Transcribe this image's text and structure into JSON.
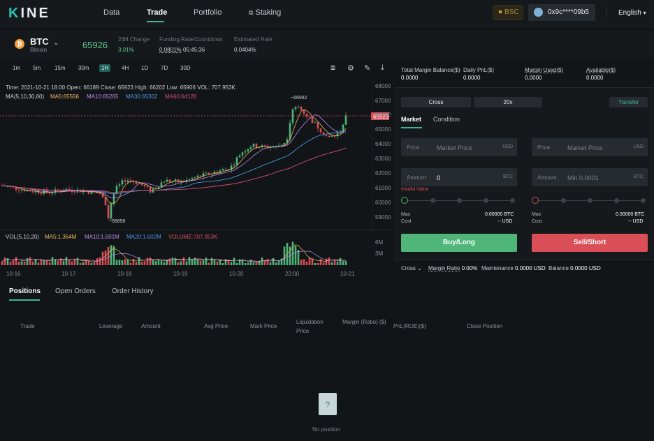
{
  "nav": {
    "logo": "KINE",
    "items": [
      "Data",
      "Trade",
      "Portfolio",
      "Staking"
    ],
    "network": "BSC",
    "address": "0x9c****09b5",
    "language": "English"
  },
  "ticker": {
    "symbol": "BTC",
    "name": "Bitcoin",
    "price": "65926",
    "change_label": "24H Change",
    "change_value": "3.01%",
    "funding_label": "Funding Rate/Countdown",
    "funding_rate": "0.0801%",
    "funding_countdown": "05:45:36",
    "est_label": "Estimated Rate",
    "est_value": "0.0404%"
  },
  "chart_toolbar": {
    "timeframes": [
      "1m",
      "5m",
      "15m",
      "30m",
      "1H",
      "4H",
      "1D",
      "7D",
      "30D"
    ],
    "active": "1H"
  },
  "chart_legend": {
    "ohlc": "Time: 2021-10-21 18:00    Open: 66189    Close: 65923    High: 66202    Low: 65906    VOL: 707.953K",
    "ma_title": "MA(5,10,30,60)",
    "ma5": "MA5:65556",
    "ma10": "MA10:65265",
    "ma30": "MA30:65302",
    "ma60": "MA60:64126",
    "vol_title": "VOL(5,10,20)",
    "vma5": "MA5:1.364M",
    "vma10": "MA10:1.601M",
    "vma20": "MA20:1.602M",
    "volume": "VOLUME:707.953K",
    "high_marker": "66982",
    "low_marker": "58856",
    "last_price_tag": "65923"
  },
  "chart_data": {
    "type": "candlestick",
    "y_ticks": [
      "68000",
      "67000",
      "66000",
      "65000",
      "64000",
      "63000",
      "62000",
      "61000",
      "60000",
      "59000"
    ],
    "vol_ticks": [
      "6M",
      "3M"
    ],
    "x_ticks": [
      "10-16",
      "10-17",
      "10-18",
      "10-19",
      "10-20",
      "22:00",
      "10-21"
    ],
    "ylim": [
      58600,
      68200
    ]
  },
  "account": {
    "total_margin_label": "Total Margin Balance($)",
    "total_margin": "0.0000",
    "daily_pnl_label": "Daily PnL($)",
    "daily_pnl": "0.0000",
    "margin_used_label": "Margin Used($)",
    "margin_used": "0.0000",
    "available_label": "Available($)",
    "available": "0.0000"
  },
  "order": {
    "mode": "Cross",
    "leverage": "20x",
    "transfer": "Transfer",
    "tab_market": "Market",
    "tab_condition": "Condition",
    "price_label": "Price",
    "price_placeholder": "Market Price",
    "unit_usd": "USD",
    "amount_label": "Amount",
    "amount_value": "0",
    "amount_placeholder": "Min 0.0001",
    "unit_btc": "BTC",
    "invalid": "Invalid Value",
    "max_label": "Max",
    "cost_label": "Cost",
    "max_value": "0.00000",
    "cost_value": "--",
    "buy": "Buy/Long",
    "sell": "Sell/Short"
  },
  "footer_bar": {
    "cross": "Cross",
    "margin_ratio_label": "Margin Ratio",
    "margin_ratio": "0.00%",
    "maintenance_label": "Maintenance",
    "maintenance": "0.0000 USD",
    "balance_label": "Balance",
    "balance": "0.0000",
    "balance_unit": "USD"
  },
  "positions": {
    "tabs": [
      "Positions",
      "Open Orders",
      "Order History"
    ],
    "columns": [
      "Trade",
      "Leverage",
      "Amount",
      "Avg Price",
      "Mark Price",
      "Liquidation Price",
      "Margin (Ratio) ($)",
      "PnL(ROE)($)",
      "Close Position"
    ],
    "empty": "No position",
    "empty_icon": "?"
  },
  "colors": {
    "up": "#4fb579",
    "down": "#d94e57",
    "accent": "#3fb58f"
  }
}
